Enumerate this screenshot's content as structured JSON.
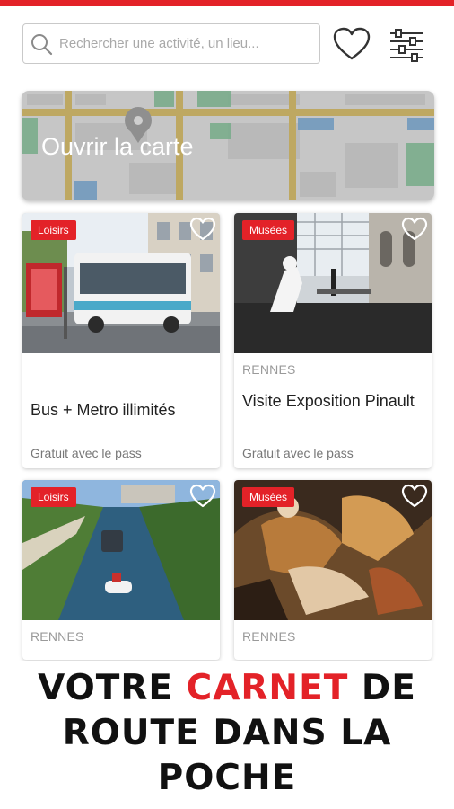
{
  "search": {
    "placeholder": "Rechercher une activité, un lieu..."
  },
  "map": {
    "label": "Ouvrir la carte"
  },
  "cards": [
    {
      "badge": "Loisirs",
      "city": "",
      "title": "Bus + Metro illimités",
      "price": "Gratuit avec le pass"
    },
    {
      "badge": "Musées",
      "city": "RENNES",
      "title": "Visite Exposition Pinault",
      "price": "Gratuit avec le pass"
    },
    {
      "badge": "Loisirs",
      "city": "RENNES",
      "title": "",
      "price": ""
    },
    {
      "badge": "Musées",
      "city": "RENNES",
      "title": "",
      "price": ""
    }
  ],
  "tagline": {
    "line1_before": "VOTRE ",
    "line1_accent": "CARNET",
    "line1_after": " DE",
    "line2": "ROUTE DANS LA",
    "line3": "POCHE"
  },
  "colors": {
    "accent": "#e32228"
  },
  "icons": [
    "search-icon",
    "heart-icon",
    "filter-icon",
    "map-pin-icon"
  ]
}
